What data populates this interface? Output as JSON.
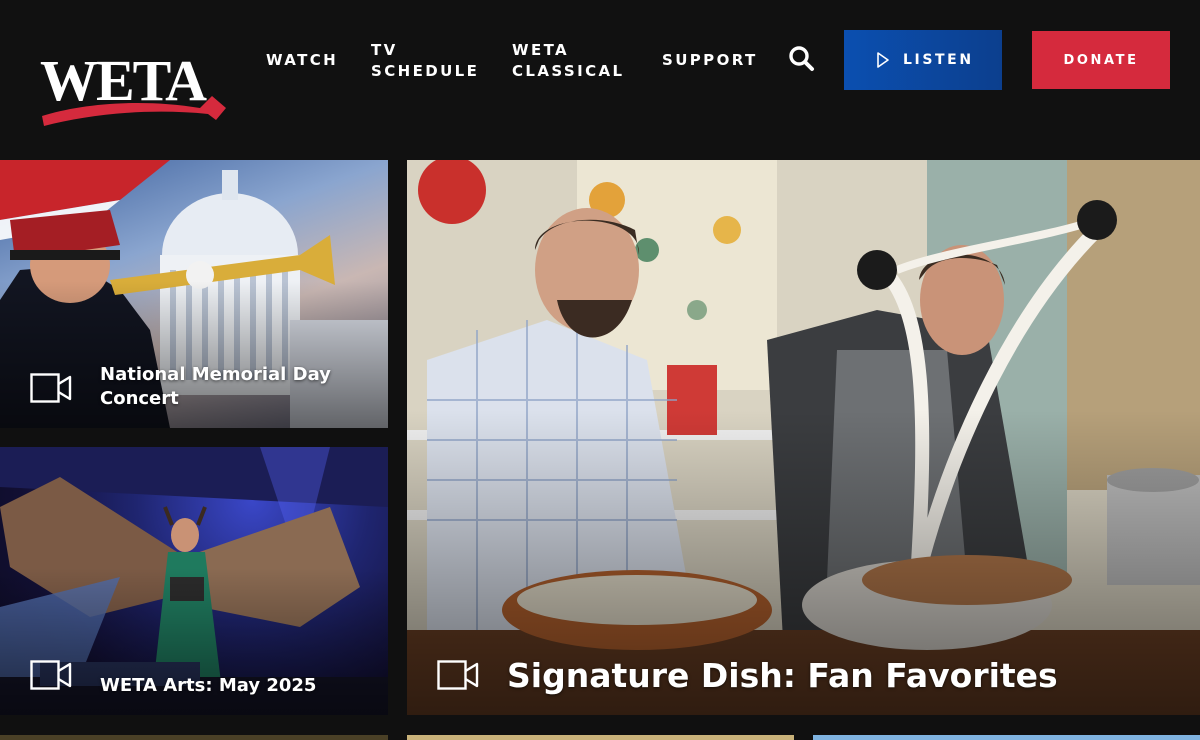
{
  "brand": {
    "logo_text": "WETA",
    "accent_color": "#d52a3d"
  },
  "nav": {
    "watch": "WATCH",
    "tv_schedule_line1": "TV",
    "tv_schedule_line2": "SCHEDULE",
    "classical_line1": "WETA",
    "classical_line2": "CLASSICAL",
    "support": "SUPPORT"
  },
  "actions": {
    "search_icon": "search-icon",
    "listen_label": "LISTEN",
    "listen_color": "#0b4fb0",
    "donate_label": "DONATE",
    "donate_color": "#d52a3d"
  },
  "cards": [
    {
      "title_line1": "National Memorial Day",
      "title_line2": "Concert",
      "icon": "video-camera-icon"
    },
    {
      "title": "WETA Arts: May 2025",
      "icon": "video-camera-icon"
    },
    {
      "title": "Signature Dish: Fan Favorites",
      "icon": "video-camera-icon"
    }
  ]
}
